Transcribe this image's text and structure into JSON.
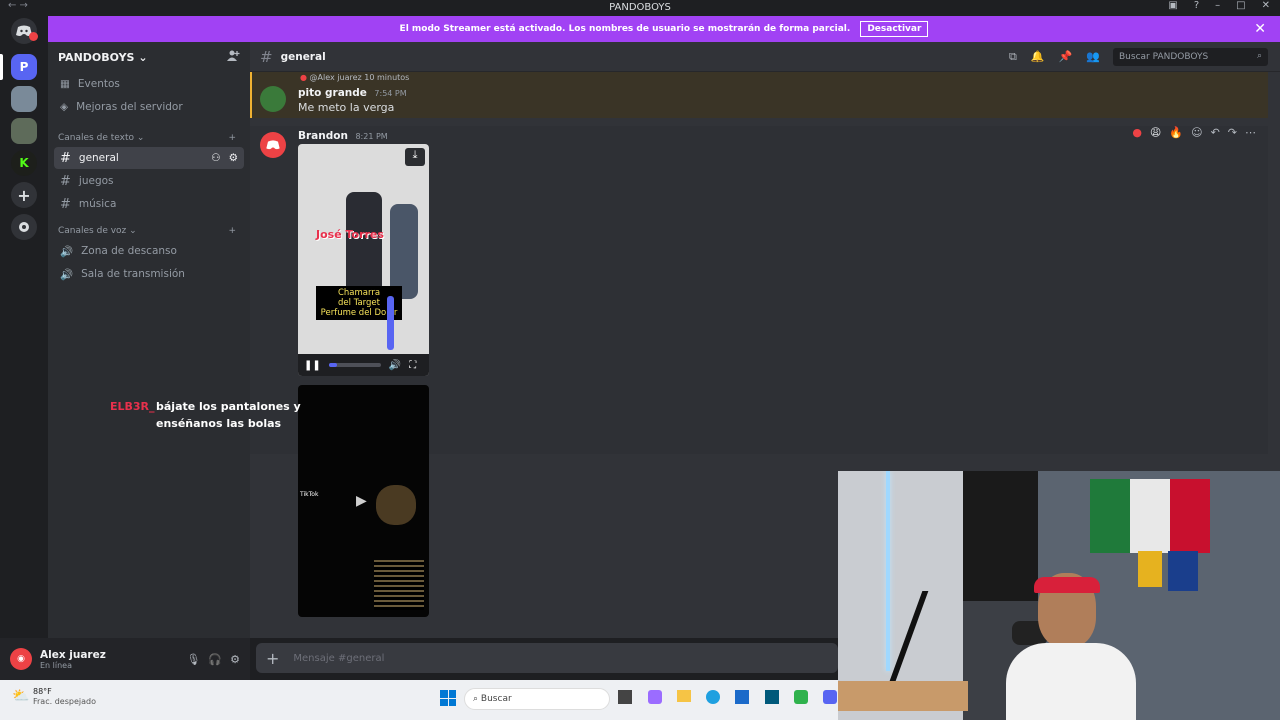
{
  "window": {
    "title": "PANDOBOYS"
  },
  "banner": {
    "text": "El modo Streamer está activado. Los nombres de usuario se mostrarán de forma parcial.",
    "button": "Desactivar"
  },
  "server": {
    "name": "PANDOBOYS"
  },
  "sidebar": {
    "top_items": [
      {
        "label": "Eventos"
      },
      {
        "label": "Mejoras del servidor"
      }
    ],
    "text_category": "Canales de texto",
    "text_channels": [
      {
        "label": "general"
      },
      {
        "label": "juegos"
      },
      {
        "label": "música"
      }
    ],
    "voice_category": "Canales de voz",
    "voice_channels": [
      {
        "label": "Zona de descanso"
      },
      {
        "label": "Sala de transmisión"
      }
    ]
  },
  "user": {
    "name": "Alex juarez",
    "status": "En línea"
  },
  "channel": {
    "name": "general",
    "search_placeholder": "Buscar PANDOBOYS"
  },
  "messages": [
    {
      "reply_to": "@Alex juarez",
      "reply_text": "10 minutos",
      "author": "pito grande",
      "time": "7:54 PM",
      "text": "Me meto la verga"
    },
    {
      "author": "Brandon",
      "time": "8:21 PM"
    }
  ],
  "video": {
    "overlay_title": "José Torres",
    "caption_lines": [
      "Chamarra",
      "del Target",
      "Perfume del Dolar"
    ],
    "progress": 0.15
  },
  "video2": {
    "brand": "TikTok"
  },
  "stream_overlay": {
    "user": "ELB3R_",
    "text": "bájate los pantalones y enséñanos las bolas"
  },
  "composer": {
    "placeholder": "Mensaje #general"
  },
  "taskbar": {
    "temp": "88°F",
    "weather": "Frac. despejado",
    "search": "Buscar"
  },
  "colors": {
    "accent": "#a142f4",
    "brand": "#5865f2",
    "danger": "#ed4245",
    "mention": "#f0b232"
  }
}
